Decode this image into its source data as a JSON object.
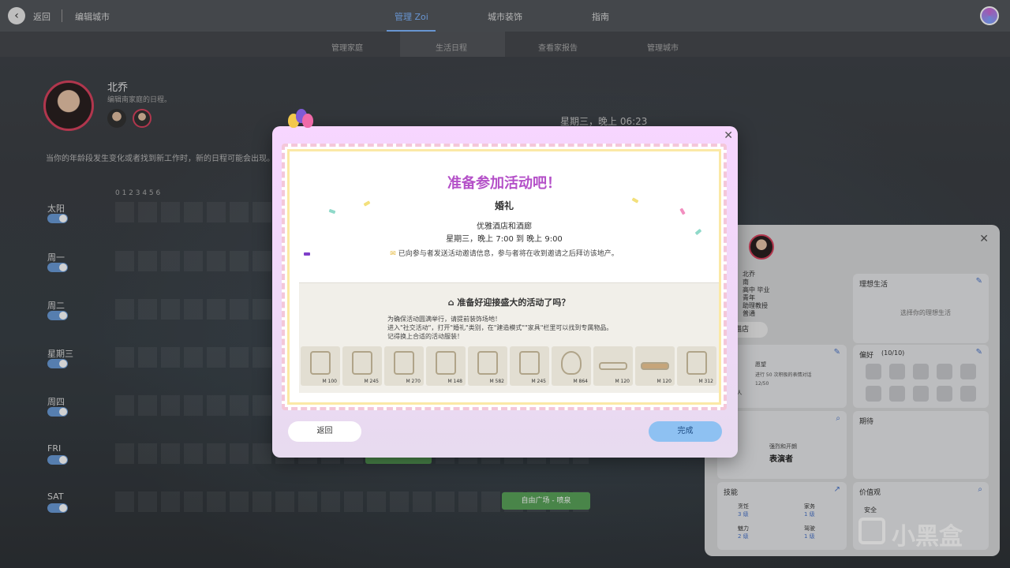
{
  "topbar": {
    "back_label": "返回",
    "crumb": "编辑城市",
    "tabs": [
      "管理 Zoi",
      "城市装饰",
      "指南"
    ]
  },
  "subtabs": [
    "管理家庭",
    "生活日程",
    "查看家报告",
    "管理城市"
  ],
  "profile": {
    "name": "北乔",
    "desc": "编辑南家庭的日程。",
    "datetime": "星期三，晚上 06:23",
    "notice": "当你的年龄段发生变化或者找到新工作时，新的日程可能会出现。"
  },
  "hours": "0   1   2   3   4   5   6",
  "days": [
    "太阳",
    "周一",
    "周二",
    "星期三",
    "周四",
    "FRI",
    "SAT"
  ],
  "events": [
    {
      "label": ""
    },
    {
      "label": "自由广场 - 喷泉"
    }
  ],
  "panel": {
    "name": "北乔",
    "info": [
      "南",
      "高中 毕业",
      "青年",
      "助理教授",
      "普通"
    ],
    "shop_label": "喵店",
    "life": "理想生活",
    "life_hint": "选择你的理想生活",
    "pref": "偏好",
    "pref_count": "(10/10)",
    "expect": "期待",
    "perform_a": "强烈和开朗",
    "perform_b": "表演者",
    "skills": "技能",
    "values": "价值观",
    "safety": "安全",
    "skill_rows": [
      [
        "烹饪",
        "3 级"
      ],
      [
        "家务",
        "1 级"
      ],
      [
        "魅力",
        "2 级"
      ],
      [
        "驾驶",
        "1 级"
      ]
    ],
    "aspiration": "愿望",
    "aspiration_desc": "进行 50 次积极的表情对话",
    "aspiration_progress": "12/50",
    "person_count": "1人"
  },
  "modal": {
    "title": "准备参加活动吧！",
    "event": "婚礼",
    "location": "优雅酒店和酒廊",
    "time": "星期三，晚上 7:00 到 晚上 9:00",
    "invite": "已向参与者发送活动邀请信息，参与者将在收到邀请之后拜访该地产。",
    "sub_title": "准备好迎接盛大的活动了吗？",
    "tips": [
      "为确保活动圆满举行，请提前装饰场地！",
      "进入\"社交活动\"，打开\"婚礼\"类别，在\"建造模式\"\"家具\"栏里可以找到专属物品。",
      "记得换上合适的活动服装！"
    ],
    "prices": [
      "M 100",
      "M 245",
      "M 270",
      "M 148",
      "M 582",
      "M 245",
      "M 864",
      "M 120",
      "M 120",
      "M 312"
    ],
    "back": "返回",
    "done": "完成"
  },
  "watermark": "小黑盒"
}
